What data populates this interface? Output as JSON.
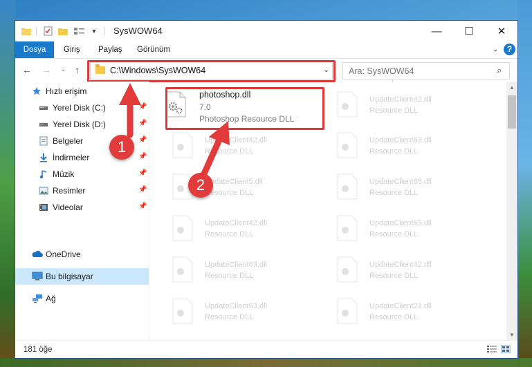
{
  "window": {
    "title": "SysWOW64",
    "minimize": "—",
    "maximize": "☐",
    "close": "✕"
  },
  "ribbon": {
    "tabs": [
      "Dosya",
      "Giriş",
      "Paylaş",
      "Görünüm"
    ],
    "help": "?"
  },
  "address": {
    "path": "C:\\Windows\\SysWOW64",
    "search_placeholder": "Ara: SysWOW64"
  },
  "nav": {
    "quick_access": "Hızlı erişim",
    "items": [
      {
        "label": "Yerel Disk (C:)",
        "icon": "drive-icon"
      },
      {
        "label": "Yerel Disk (D:)",
        "icon": "drive-icon"
      },
      {
        "label": "Belgeler",
        "icon": "documents-icon"
      },
      {
        "label": "İndirmeler",
        "icon": "download-icon"
      },
      {
        "label": "Müzik",
        "icon": "music-icon"
      },
      {
        "label": "Resimler",
        "icon": "pictures-icon"
      },
      {
        "label": "Videolar",
        "icon": "videos-icon"
      }
    ],
    "onedrive": "OneDrive",
    "this_pc": "Bu bilgisayar",
    "network": "Ağ"
  },
  "files": {
    "selected": {
      "name": "photoshop.dll",
      "version": "7.0",
      "description": "Photoshop Resource DLL"
    },
    "ghost_left": [
      {
        "name": "UpdateClient42.dll",
        "description": "Resource DLL"
      },
      {
        "name": "UpdateClient5.dll",
        "description": "Resource DLL"
      },
      {
        "name": "UpdateClient42.dll",
        "description": "Resource DLL"
      },
      {
        "name": "UpdateClient63.dll",
        "description": "Resource DLL"
      },
      {
        "name": "UpdateClient63.dll",
        "description": "Resource DLL"
      }
    ],
    "ghost_right": [
      {
        "name": "UpdateClient42.dll",
        "description": "Resource DLL"
      },
      {
        "name": "UpdateClient63.dll",
        "description": "Resource DLL"
      },
      {
        "name": "UpdateClient65.dll",
        "description": "Resource DLL"
      },
      {
        "name": "UpdateClient65.dll",
        "description": "Resource DLL"
      },
      {
        "name": "UpdateClient42.dll",
        "description": "Resource DLL"
      },
      {
        "name": "UpdateClient21.dll",
        "description": "Resource DLL"
      }
    ]
  },
  "status": {
    "count": "181 öğe"
  },
  "annotations": {
    "step1": "1",
    "step2": "2"
  },
  "colors": {
    "accent": "#1979ca",
    "highlight": "#d93a3a",
    "selection": "#cce8ff"
  }
}
